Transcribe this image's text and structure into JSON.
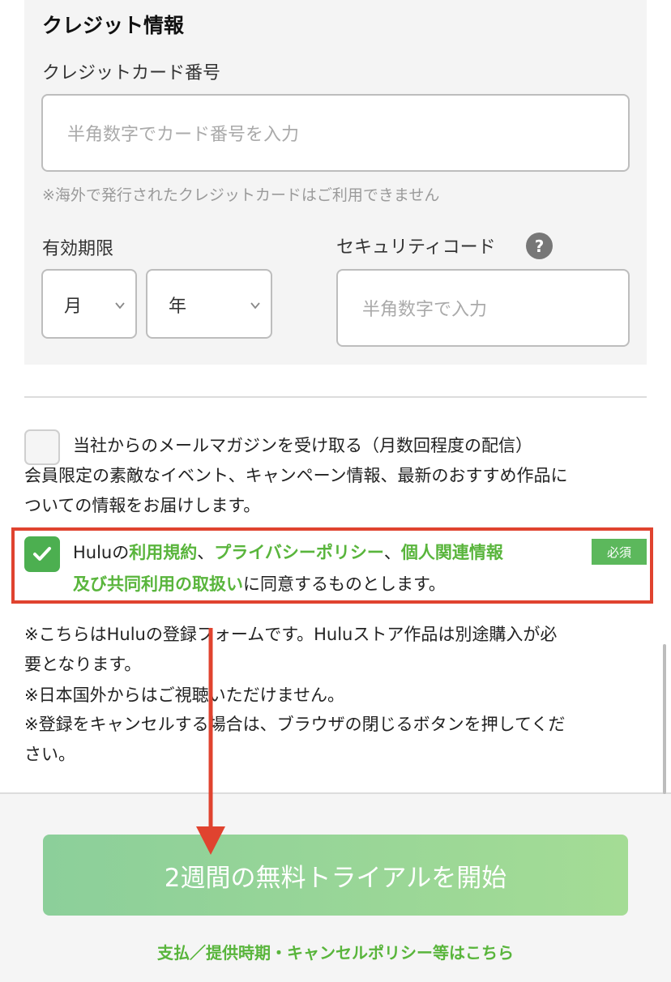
{
  "credit": {
    "title": "クレジット情報",
    "card_label": "クレジットカード番号",
    "card_placeholder": "半角数字でカード番号を入力",
    "card_note": "※海外で発行されたクレジットカードはご利用できません",
    "expiry_label": "有効期限",
    "month_label": "月",
    "year_label": "年",
    "security_label": "セキュリティコード",
    "security_help": "?",
    "security_placeholder": "半角数字で入力"
  },
  "newsletter": {
    "label": "当社からのメールマガジンを受け取る（月数回程度の配信）",
    "desc_line1": "会員限定の素敵なイベント、キャンペーン情報、最新のおすすめ作品に",
    "desc_line2": "ついての情報をお届けします。",
    "checked": false
  },
  "agreement": {
    "prefix": "Huluの",
    "terms": "利用規約",
    "sep1": "、",
    "privacy": "プライバシーポリシー",
    "sep2": "、",
    "personal": "個人関連情報",
    "joint_use": "及び共同利用の取扱い",
    "suffix": "に同意するものとします。",
    "required": "必須",
    "checked": true
  },
  "notes": {
    "line1": "※こちらはHuluの登録フォームです。Huluストア作品は別途購入が必",
    "line2": "要となります。",
    "line3": "※日本国外からはご視聴いただけません。",
    "line4": "※登録をキャンセルする場合は、ブラウザの閉じるボタンを押してくだ",
    "line5": "さい。"
  },
  "footer": {
    "start_button": "2週間の無料トライアルを開始",
    "policy_link": "支払／提供時期・キャンセルポリシー等はこちら"
  },
  "colors": {
    "accent_green": "#59b53c",
    "annotation_red": "#e0432f",
    "button_gradient_start": "#8ccf9a",
    "button_gradient_end": "#a4dc95"
  },
  "icons": [
    "chevron-down-icon",
    "question-icon",
    "check-icon",
    "arrow-down-icon"
  ]
}
